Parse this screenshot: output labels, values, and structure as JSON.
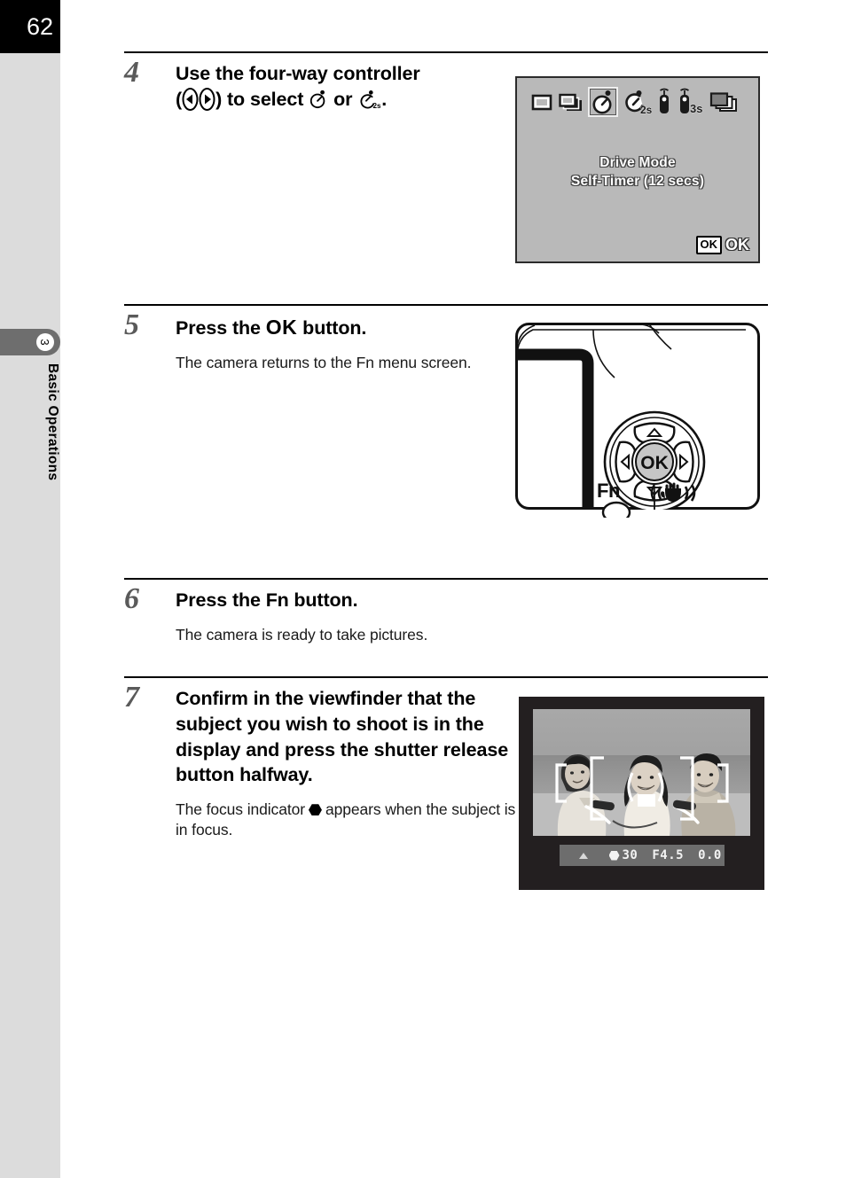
{
  "page": {
    "number": "62",
    "chapter_number": "3",
    "chapter_title": "Basic Operations"
  },
  "steps": [
    {
      "number": "4",
      "heading_part1": "Use the four-way controller",
      "heading_part2_open": "(",
      "heading_part2_mid": ") to select",
      "heading_part2_or": "or",
      "heading_part2_end": ".",
      "icons": [
        "left-arrow-key-icon",
        "right-arrow-key-icon",
        "self-timer-12s-icon",
        "self-timer-2s-icon"
      ],
      "body": ""
    },
    {
      "number": "5",
      "heading_pre": "Press the",
      "heading_glyph": "OK",
      "heading_post": "button.",
      "body": "The camera returns to the Fn menu screen."
    },
    {
      "number": "6",
      "heading_pre": "Press the",
      "heading_glyph": "Fn",
      "heading_post": "button.",
      "body": "The camera is ready to take pictures."
    },
    {
      "number": "7",
      "heading": "Confirm in the viewfinder that the subject you wish to shoot is in the display and press the shutter release button halfway.",
      "body_pre": "The focus indicator",
      "body_post": "appears when the subject is in focus."
    }
  ],
  "lcd_screen": {
    "caption_line1": "Drive Mode",
    "caption_line2": "Self-Timer (12 secs)",
    "ok_badge": "OK",
    "ok_label": "OK",
    "drive_modes": [
      {
        "name": "single-frame-icon",
        "label": "",
        "selected": false
      },
      {
        "name": "continuous-shooting-icon",
        "label": "",
        "selected": false
      },
      {
        "name": "self-timer-12s-icon",
        "label": "",
        "selected": true
      },
      {
        "name": "self-timer-2s-icon",
        "label": "2s",
        "selected": false
      },
      {
        "name": "remote-control-icon",
        "label": "",
        "selected": false
      },
      {
        "name": "remote-control-3s-icon",
        "label": "3s",
        "selected": false
      },
      {
        "name": "exposure-bracketing-icon",
        "label": "",
        "selected": false
      }
    ]
  },
  "camera_back": {
    "ok_button_label": "OK",
    "fn_button_label": "Fn",
    "shake_reduction_label": "shake-reduction-icon"
  },
  "viewfinder": {
    "shutter_speed": "30",
    "aperture": "F4.5",
    "exposure_compensation": "0.0",
    "focus_indicator": "focus-confirm-dot"
  },
  "colors": {
    "page_tab_black": "#000000",
    "sidebar_gray": "#dcdcdc",
    "chapter_tab_gray": "#6e6e6e",
    "lcd_gray": "#b9b9b9",
    "step_number_gray": "#5a5a5a",
    "viewfinder_frame": "#231f20"
  }
}
